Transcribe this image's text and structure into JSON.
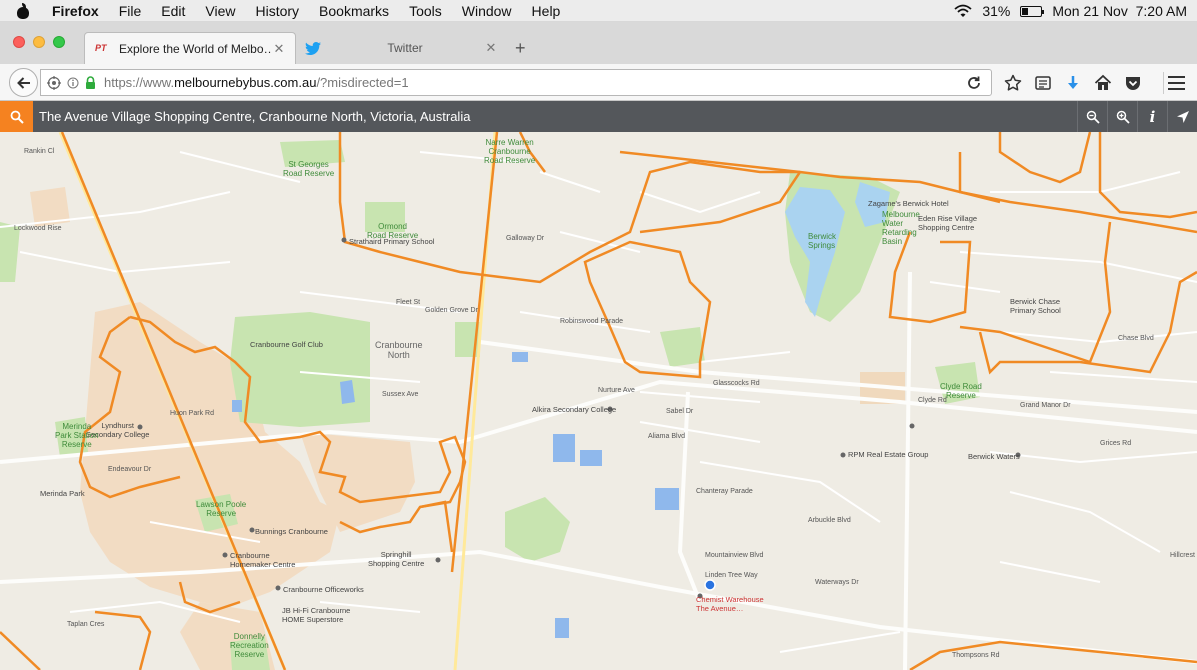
{
  "menubar": {
    "app": "Firefox",
    "items": [
      "File",
      "Edit",
      "View",
      "History",
      "Bookmarks",
      "Tools",
      "Window",
      "Help"
    ],
    "battery": "31%",
    "battery_level": 0.31,
    "datetime": "Mon 21 Nov  7:20 AM",
    "icons": [
      "apple-icon",
      "wifi-icon",
      "battery-icon"
    ]
  },
  "tabs": [
    {
      "title": "Explore the World of Melbo…",
      "favicon": "PT",
      "active": true
    },
    {
      "title": "Twitter",
      "favicon": "twitter-icon",
      "active": false
    }
  ],
  "navbar": {
    "url_prefix": "https://www.",
    "url_host": "melbournebybus.com.au",
    "url_path": "/?misdirected=1",
    "icons": [
      "back-icon",
      "site-identity-icon",
      "info-icon",
      "lock-icon",
      "reload-icon",
      "bookmark-star-icon",
      "reading-list-icon",
      "download-icon",
      "home-icon",
      "pocket-icon",
      "menu-icon"
    ]
  },
  "searchbar": {
    "location": "The Avenue Village Shopping Centre, Cranbourne North, Victoria, Australia",
    "tool_info": "i",
    "accent": "#f58220"
  },
  "map": {
    "route_color": "#f08a24",
    "labels": [
      {
        "t": "Cranbourne\nNorth",
        "cls": "big"
      },
      {
        "t": "Cranbourne Golf Club",
        "cls": "poi"
      },
      {
        "t": "Strathaird Primary School",
        "cls": "poi"
      },
      {
        "t": "Ormond\nRoad Reserve",
        "cls": "park"
      },
      {
        "t": "St Georges\nRoad Reserve",
        "cls": "park"
      },
      {
        "t": "Narre Warren\nCranbourne\nRoad Reserve",
        "cls": "park"
      },
      {
        "t": "Berwick\nSprings",
        "cls": "park"
      },
      {
        "t": "Melbourne\nWater\nRetarding\nBasin",
        "cls": "park"
      },
      {
        "t": "Eden Rise Village\nShopping Centre",
        "cls": "poi"
      },
      {
        "t": "Zagame's Berwick Hotel",
        "cls": "poi"
      },
      {
        "t": "Berwick Chase\nPrimary School",
        "cls": "poi"
      },
      {
        "t": "Clyde Road\nReserve",
        "cls": "park"
      },
      {
        "t": "Berwick Waters",
        "cls": "poi"
      },
      {
        "t": "Alkira Secondary College",
        "cls": "poi"
      },
      {
        "t": "RPM Real Estate Group",
        "cls": "poi"
      },
      {
        "t": "Lyndhurst\nSecondary College",
        "cls": "poi"
      },
      {
        "t": "Merinda\nPark Station\nReserve",
        "cls": "park"
      },
      {
        "t": "Merinda Park",
        "cls": "poi"
      },
      {
        "t": "Bunnings Cranbourne",
        "cls": "poi"
      },
      {
        "t": "Springhill\nShopping Centre",
        "cls": "poi"
      },
      {
        "t": "Cranbourne\nHomemaker Centre",
        "cls": "poi"
      },
      {
        "t": "Cranbourne Officeworks",
        "cls": "poi"
      },
      {
        "t": "JB Hi-Fi Cranbourne\nHOME Superstore",
        "cls": "poi"
      },
      {
        "t": "Lawson Poole\nReserve",
        "cls": "park"
      },
      {
        "t": "Donnelly\nRecreation\nReserve",
        "cls": "park"
      },
      {
        "t": "Chemist Warehouse\nThe Avenue…",
        "cls": "poi"
      },
      {
        "t": "Glasscocks Rd",
        "cls": ""
      },
      {
        "t": "Thompsons Rd",
        "cls": ""
      },
      {
        "t": "Clyde Rd",
        "cls": ""
      },
      {
        "t": "Linden Tree Way",
        "cls": ""
      },
      {
        "t": "Mountainview Blvd",
        "cls": ""
      },
      {
        "t": "Chase Blvd",
        "cls": ""
      },
      {
        "t": "Grices Rd",
        "cls": ""
      },
      {
        "t": "Golden Grove Dr",
        "cls": ""
      },
      {
        "t": "Sussex Ave",
        "cls": ""
      },
      {
        "t": "Fleet St",
        "cls": ""
      },
      {
        "t": "Galloway Dr",
        "cls": ""
      },
      {
        "t": "Robinswood Parade",
        "cls": ""
      },
      {
        "t": "Nurture Ave",
        "cls": ""
      },
      {
        "t": "Sabel Dr",
        "cls": ""
      },
      {
        "t": "Aliama Blvd",
        "cls": ""
      },
      {
        "t": "Chanteray Parade",
        "cls": ""
      },
      {
        "t": "Arbuckle Blvd",
        "cls": ""
      },
      {
        "t": "Waterways Dr",
        "cls": ""
      },
      {
        "t": "Huon Park Rd",
        "cls": ""
      },
      {
        "t": "Endeavour Dr",
        "cls": ""
      },
      {
        "t": "Taplan Cres",
        "cls": ""
      },
      {
        "t": "Hillcrest",
        "cls": ""
      },
      {
        "t": "Grand Manor Dr",
        "cls": ""
      },
      {
        "t": "Rankin Cl",
        "cls": ""
      },
      {
        "t": "Lockwood Rise",
        "cls": ""
      }
    ]
  }
}
